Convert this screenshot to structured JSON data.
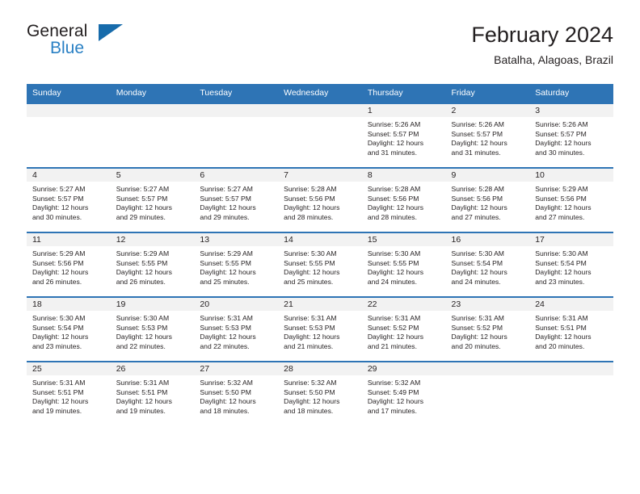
{
  "logo": {
    "primary_text": "General",
    "secondary_text": "Blue",
    "primary_color": "#231f20",
    "secondary_color": "#2980c4",
    "triangle_color": "#176bab"
  },
  "header": {
    "title": "February 2024",
    "location": "Batalha, Alagoas, Brazil"
  },
  "theme": {
    "header_blue": "#2e74b5",
    "row_rule_blue": "#2e74b5",
    "daynum_band_gray": "#f2f2f2",
    "text_color": "#231f20"
  },
  "calendar": {
    "weekday_headers": [
      "Sunday",
      "Monday",
      "Tuesday",
      "Wednesday",
      "Thursday",
      "Friday",
      "Saturday"
    ],
    "weeks": [
      [
        {
          "day": "",
          "lines": []
        },
        {
          "day": "",
          "lines": []
        },
        {
          "day": "",
          "lines": []
        },
        {
          "day": "",
          "lines": []
        },
        {
          "day": "1",
          "lines": [
            "Sunrise: 5:26 AM",
            "Sunset: 5:57 PM",
            "Daylight: 12 hours",
            "and 31 minutes."
          ]
        },
        {
          "day": "2",
          "lines": [
            "Sunrise: 5:26 AM",
            "Sunset: 5:57 PM",
            "Daylight: 12 hours",
            "and 31 minutes."
          ]
        },
        {
          "day": "3",
          "lines": [
            "Sunrise: 5:26 AM",
            "Sunset: 5:57 PM",
            "Daylight: 12 hours",
            "and 30 minutes."
          ]
        }
      ],
      [
        {
          "day": "4",
          "lines": [
            "Sunrise: 5:27 AM",
            "Sunset: 5:57 PM",
            "Daylight: 12 hours",
            "and 30 minutes."
          ]
        },
        {
          "day": "5",
          "lines": [
            "Sunrise: 5:27 AM",
            "Sunset: 5:57 PM",
            "Daylight: 12 hours",
            "and 29 minutes."
          ]
        },
        {
          "day": "6",
          "lines": [
            "Sunrise: 5:27 AM",
            "Sunset: 5:57 PM",
            "Daylight: 12 hours",
            "and 29 minutes."
          ]
        },
        {
          "day": "7",
          "lines": [
            "Sunrise: 5:28 AM",
            "Sunset: 5:56 PM",
            "Daylight: 12 hours",
            "and 28 minutes."
          ]
        },
        {
          "day": "8",
          "lines": [
            "Sunrise: 5:28 AM",
            "Sunset: 5:56 PM",
            "Daylight: 12 hours",
            "and 28 minutes."
          ]
        },
        {
          "day": "9",
          "lines": [
            "Sunrise: 5:28 AM",
            "Sunset: 5:56 PM",
            "Daylight: 12 hours",
            "and 27 minutes."
          ]
        },
        {
          "day": "10",
          "lines": [
            "Sunrise: 5:29 AM",
            "Sunset: 5:56 PM",
            "Daylight: 12 hours",
            "and 27 minutes."
          ]
        }
      ],
      [
        {
          "day": "11",
          "lines": [
            "Sunrise: 5:29 AM",
            "Sunset: 5:56 PM",
            "Daylight: 12 hours",
            "and 26 minutes."
          ]
        },
        {
          "day": "12",
          "lines": [
            "Sunrise: 5:29 AM",
            "Sunset: 5:55 PM",
            "Daylight: 12 hours",
            "and 26 minutes."
          ]
        },
        {
          "day": "13",
          "lines": [
            "Sunrise: 5:29 AM",
            "Sunset: 5:55 PM",
            "Daylight: 12 hours",
            "and 25 minutes."
          ]
        },
        {
          "day": "14",
          "lines": [
            "Sunrise: 5:30 AM",
            "Sunset: 5:55 PM",
            "Daylight: 12 hours",
            "and 25 minutes."
          ]
        },
        {
          "day": "15",
          "lines": [
            "Sunrise: 5:30 AM",
            "Sunset: 5:55 PM",
            "Daylight: 12 hours",
            "and 24 minutes."
          ]
        },
        {
          "day": "16",
          "lines": [
            "Sunrise: 5:30 AM",
            "Sunset: 5:54 PM",
            "Daylight: 12 hours",
            "and 24 minutes."
          ]
        },
        {
          "day": "17",
          "lines": [
            "Sunrise: 5:30 AM",
            "Sunset: 5:54 PM",
            "Daylight: 12 hours",
            "and 23 minutes."
          ]
        }
      ],
      [
        {
          "day": "18",
          "lines": [
            "Sunrise: 5:30 AM",
            "Sunset: 5:54 PM",
            "Daylight: 12 hours",
            "and 23 minutes."
          ]
        },
        {
          "day": "19",
          "lines": [
            "Sunrise: 5:30 AM",
            "Sunset: 5:53 PM",
            "Daylight: 12 hours",
            "and 22 minutes."
          ]
        },
        {
          "day": "20",
          "lines": [
            "Sunrise: 5:31 AM",
            "Sunset: 5:53 PM",
            "Daylight: 12 hours",
            "and 22 minutes."
          ]
        },
        {
          "day": "21",
          "lines": [
            "Sunrise: 5:31 AM",
            "Sunset: 5:53 PM",
            "Daylight: 12 hours",
            "and 21 minutes."
          ]
        },
        {
          "day": "22",
          "lines": [
            "Sunrise: 5:31 AM",
            "Sunset: 5:52 PM",
            "Daylight: 12 hours",
            "and 21 minutes."
          ]
        },
        {
          "day": "23",
          "lines": [
            "Sunrise: 5:31 AM",
            "Sunset: 5:52 PM",
            "Daylight: 12 hours",
            "and 20 minutes."
          ]
        },
        {
          "day": "24",
          "lines": [
            "Sunrise: 5:31 AM",
            "Sunset: 5:51 PM",
            "Daylight: 12 hours",
            "and 20 minutes."
          ]
        }
      ],
      [
        {
          "day": "25",
          "lines": [
            "Sunrise: 5:31 AM",
            "Sunset: 5:51 PM",
            "Daylight: 12 hours",
            "and 19 minutes."
          ]
        },
        {
          "day": "26",
          "lines": [
            "Sunrise: 5:31 AM",
            "Sunset: 5:51 PM",
            "Daylight: 12 hours",
            "and 19 minutes."
          ]
        },
        {
          "day": "27",
          "lines": [
            "Sunrise: 5:32 AM",
            "Sunset: 5:50 PM",
            "Daylight: 12 hours",
            "and 18 minutes."
          ]
        },
        {
          "day": "28",
          "lines": [
            "Sunrise: 5:32 AM",
            "Sunset: 5:50 PM",
            "Daylight: 12 hours",
            "and 18 minutes."
          ]
        },
        {
          "day": "29",
          "lines": [
            "Sunrise: 5:32 AM",
            "Sunset: 5:49 PM",
            "Daylight: 12 hours",
            "and 17 minutes."
          ]
        },
        {
          "day": "",
          "lines": []
        },
        {
          "day": "",
          "lines": []
        }
      ]
    ]
  }
}
